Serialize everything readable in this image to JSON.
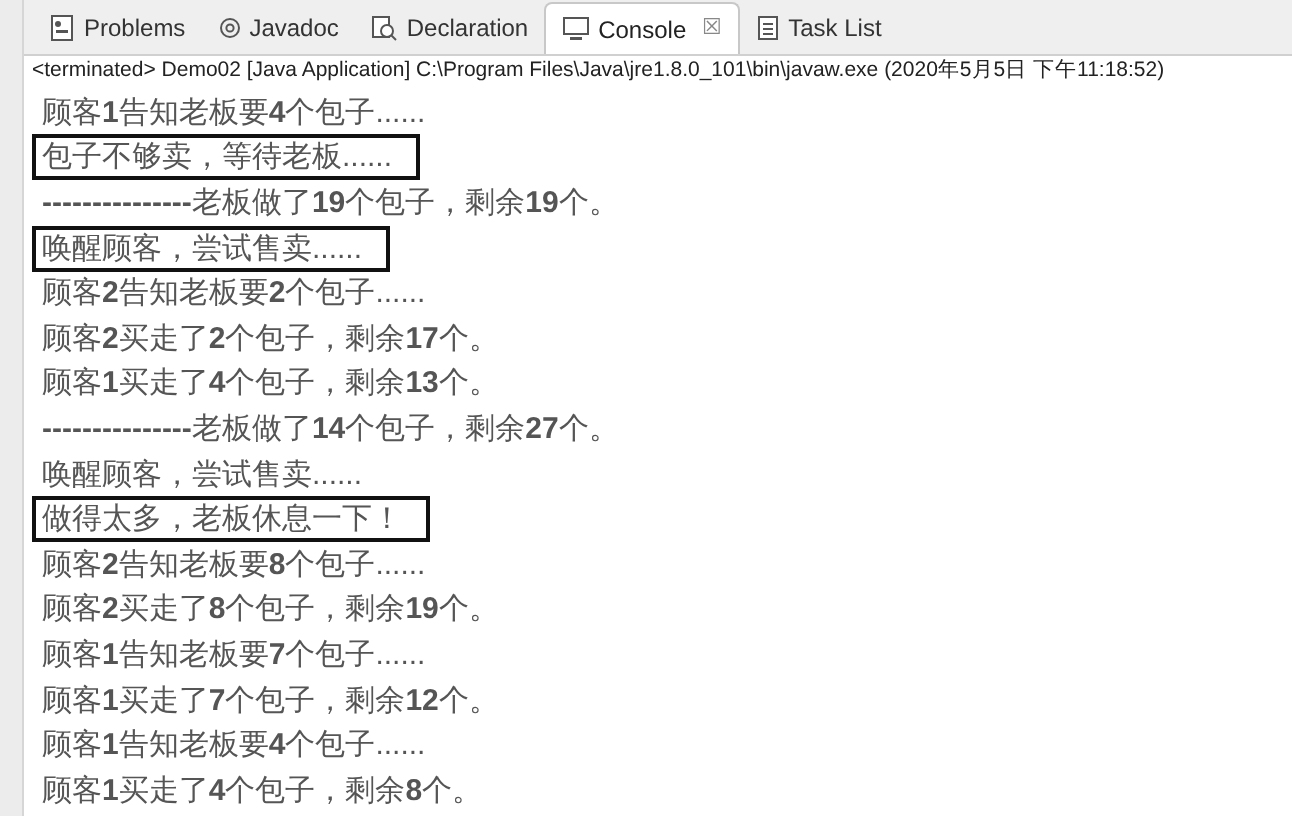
{
  "tabs": [
    {
      "label": "Problems",
      "kind": "problems",
      "selected": false
    },
    {
      "label": "Javadoc",
      "kind": "at",
      "selected": false
    },
    {
      "label": "Declaration",
      "kind": "declaration",
      "selected": false
    },
    {
      "label": "Console",
      "kind": "console",
      "selected": true,
      "close": "☒"
    },
    {
      "label": "Task List",
      "kind": "tasks",
      "selected": false
    }
  ],
  "status": "<terminated> Demo02 [Java Application] C:\\Program Files\\Java\\jre1.8.0_101\\bin\\javaw.exe (2020年5月5日 下午11:18:52)",
  "lines": [
    {
      "text": "顾客**1**告知老板要**4**个包子......",
      "boxed": false
    },
    {
      "text": "包子不够卖，等待老板......",
      "boxed": true
    },
    {
      "text": "**---------------**老板做了**19**个包子，剩余**19**个。",
      "boxed": false
    },
    {
      "text": "唤醒顾客，尝试售卖......",
      "boxed": true
    },
    {
      "text": "顾客**2**告知老板要**2**个包子......",
      "boxed": false
    },
    {
      "text": "顾客**2**买走了**2**个包子，剩余**17**个。",
      "boxed": false
    },
    {
      "text": "顾客**1**买走了**4**个包子，剩余**13**个。",
      "boxed": false
    },
    {
      "text": "**---------------**老板做了**14**个包子，剩余**27**个。",
      "boxed": false
    },
    {
      "text": "唤醒顾客，尝试售卖......",
      "boxed": false
    },
    {
      "text": "做得太多，老板休息一下！",
      "boxed": true
    },
    {
      "text": "顾客**2**告知老板要**8**个包子......",
      "boxed": false
    },
    {
      "text": "顾客**2**买走了**8**个包子，剩余**19**个。",
      "boxed": false
    },
    {
      "text": "顾客**1**告知老板要**7**个包子......",
      "boxed": false
    },
    {
      "text": "顾客**1**买走了**7**个包子，剩余**12**个。",
      "boxed": false
    },
    {
      "text": "顾客**1**告知老板要**4**个包子......",
      "boxed": false
    },
    {
      "text": "顾客**1**买走了**4**个包子，剩余**8**个。",
      "boxed": false
    }
  ]
}
